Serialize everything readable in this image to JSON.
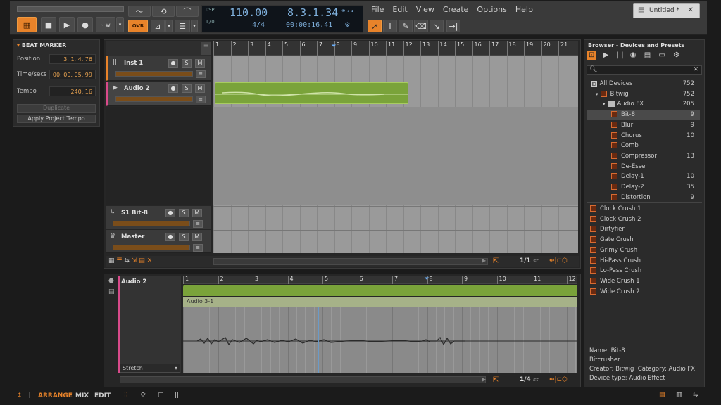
{
  "transport": {
    "ovr_label": "OVR"
  },
  "lcd": {
    "dsp_label": "DSP",
    "io_label": "I/O",
    "tempo": "110.00",
    "signature": "4/4",
    "position": "8.3.1.34",
    "time": "00:00:16.41"
  },
  "menu": [
    "File",
    "Edit",
    "View",
    "Create",
    "Options",
    "Help"
  ],
  "window": {
    "tab_title": "Untitled *"
  },
  "inspector": {
    "title": "BEAT MARKER",
    "position_label": "Position",
    "position_value": "3. 1. 4. 76",
    "time_label": "Time/secs",
    "time_value": "00: 00. 05. 99",
    "tempo_label": "Tempo",
    "tempo_value": "240. 16",
    "duplicate_label": "Duplicate",
    "apply_label": "Apply Project Tempo"
  },
  "arranger": {
    "ruler": [
      "1",
      "2",
      "3",
      "4",
      "5",
      "6",
      "7",
      "8",
      "9",
      "10",
      "11",
      "12",
      "13",
      "14",
      "15",
      "16",
      "17",
      "18",
      "19",
      "20",
      "21"
    ],
    "tracks": [
      {
        "name": "Inst 1"
      },
      {
        "name": "Audio 2"
      },
      {
        "name": "S1 Bit-8"
      },
      {
        "name": "Master"
      }
    ],
    "zoom": "1/1",
    "zoom_unit": "st"
  },
  "editor": {
    "track": "Audio 2",
    "clip": "Audio 3-1",
    "mode": "Stretch",
    "zoom": "1/4",
    "zoom_unit": "st",
    "ruler": [
      "1",
      "2",
      "3",
      "4",
      "5",
      "6",
      "7",
      "8",
      "9",
      "10",
      "11",
      "12"
    ]
  },
  "browser": {
    "title": "Browser - Devices and Presets",
    "tree": [
      {
        "label": "All Devices",
        "count": "752"
      },
      {
        "label": "Bitwig",
        "count": "752"
      },
      {
        "label": "Audio FX",
        "count": "205"
      },
      {
        "label": "Bit-8",
        "count": "9"
      },
      {
        "label": "Blur",
        "count": "9"
      },
      {
        "label": "Chorus",
        "count": "10"
      },
      {
        "label": "Comb",
        "count": ""
      },
      {
        "label": "Compressor",
        "count": "13"
      },
      {
        "label": "De-Esser",
        "count": ""
      },
      {
        "label": "Delay-1",
        "count": "10"
      },
      {
        "label": "Delay-2",
        "count": "35"
      },
      {
        "label": "Distortion",
        "count": "9"
      }
    ],
    "presets": [
      "Clock Crush 1",
      "Clock Crush 2",
      "Dirtyfier",
      "Gate Crush",
      "Grimy Crush",
      "Hi-Pass Crush",
      "Lo-Pass Crush",
      "Wide Crush 1",
      "Wide Crush 2"
    ],
    "info": {
      "name": "Name: Bit-8",
      "desc": "Bitcrusher",
      "creator": "Creator: Bitwig",
      "category": "Category: Audio FX",
      "type": "Device type: Audio Effect"
    }
  },
  "bottom": {
    "arrange": "ARRANGE",
    "mix": "MIX",
    "edit": "EDIT"
  },
  "colors": {
    "accent": "#e8832a",
    "clip_green": "#7aa33a",
    "track_inst": "#e8832a",
    "track_audio": "#d84a8a"
  }
}
